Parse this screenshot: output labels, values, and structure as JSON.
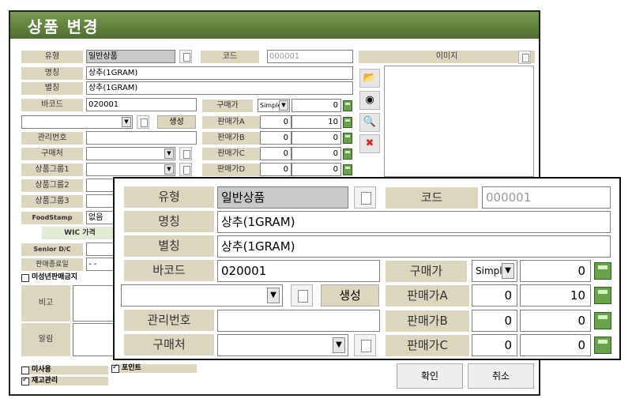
{
  "window": {
    "title": "상품 변경"
  },
  "form": {
    "type_label": "유형",
    "type_value": "일반상품",
    "code_label": "코드",
    "code_value": "000001",
    "image_label": "이미지",
    "name_label": "명칭",
    "name_value": "상추(1GRAM)",
    "alias_label": "별칭",
    "alias_value": "상추(1GRAM)",
    "barcode_label": "바코드",
    "barcode_value": "020001",
    "cost_label": "구매가",
    "cost_mode": "Simple",
    "cost_value": "0",
    "generate_label": "생성",
    "price_a_label": "판매가A",
    "price_a_1": "0",
    "price_a_2": "10",
    "price_b_label": "판매가B",
    "price_b_1": "0",
    "price_b_2": "0",
    "price_c_label": "판매가C",
    "price_c_1": "0",
    "price_c_2": "0",
    "price_d_label": "판매가D",
    "price_d_1": "0",
    "price_d_2": "0",
    "mgmt_label": "관리번호",
    "vendor_label": "구매처",
    "group1_label": "상품그룹1",
    "group2_label": "상품그룹2",
    "group3_label": "상품그룹3",
    "foodstamp_label": "FoodStamp",
    "foodstamp_value": "없음",
    "wic_label": "WIC 가격",
    "senior_label": "Senior D/C",
    "enddate_label": "판매종료일",
    "enddate_value": "- -",
    "minor_label": "미성년판매금지",
    "memo_label": "비고",
    "alert_label": "알림",
    "unused_label": "미사용",
    "point_label": "포인트",
    "stock_label": "재고관리",
    "ok_label": "확인",
    "cancel_label": "취소"
  },
  "colors": {
    "title_bar": "#5b7b3a",
    "label_bg": "#ddd6bf",
    "calc_icon": "#6aa14b"
  }
}
